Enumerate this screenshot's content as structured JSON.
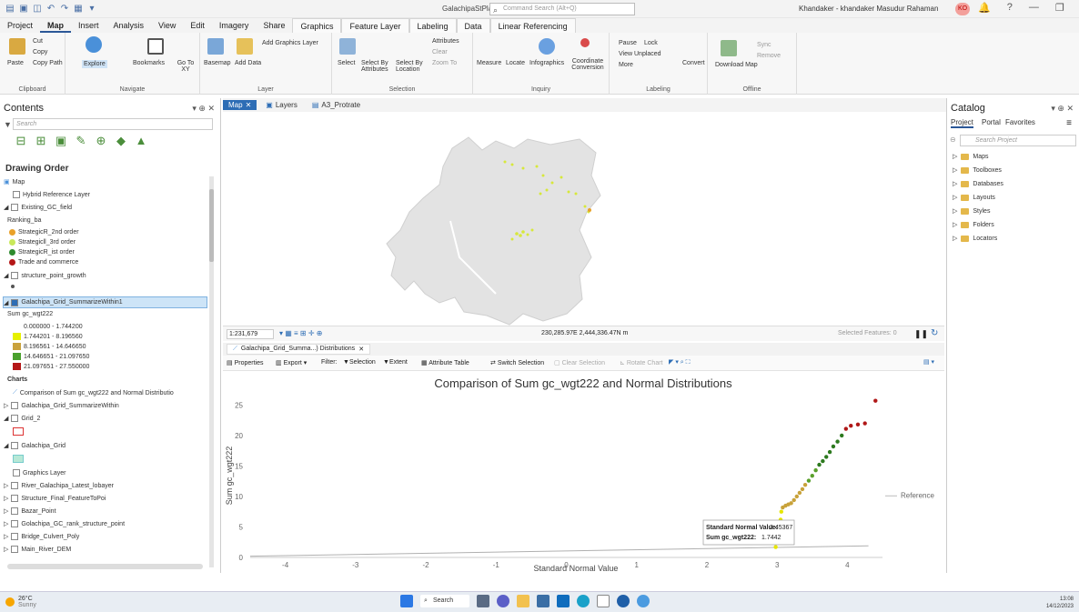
{
  "titlebar": {
    "app_title": "GalachipaStPlan",
    "command_search": "Command Search (Alt+Q)",
    "user": "Khandaker - khandaker Masudur Rahaman",
    "user_initials": "KO"
  },
  "ribbon_tabs": [
    "Project",
    "Map",
    "Insert",
    "Analysis",
    "View",
    "Edit",
    "Imagery",
    "Share",
    "Graphics",
    "Feature Layer",
    "Labeling",
    "Data",
    "Linear Referencing"
  ],
  "ribbon": {
    "clipboard": {
      "paste": "Paste",
      "cut": "Cut",
      "copy": "Copy",
      "copy_path": "Copy Path",
      "label": "Clipboard"
    },
    "navigate": {
      "explore": "Explore",
      "bookmarks": "Bookmarks",
      "goto": "Go To XY",
      "label": "Navigate"
    },
    "layer": {
      "basemap": "Basemap",
      "add_data": "Add Data",
      "add_graphics": "Add Graphics Layer",
      "label": "Layer"
    },
    "selection": {
      "select": "Select",
      "by_attr": "Select By Attributes",
      "by_loc": "Select By Location",
      "attributes": "Attributes",
      "clear": "Clear",
      "zoom_to": "Zoom To",
      "label": "Selection"
    },
    "inquiry": {
      "measure": "Measure",
      "locate": "Locate",
      "infographics": "Infographics",
      "coord": "Coordinate Conversion",
      "label": "Inquiry"
    },
    "labeling": {
      "pause": "Pause",
      "lock": "Lock",
      "view_unplaced": "View Unplaced",
      "more": "More",
      "convert": "Convert",
      "label": "Labeling"
    },
    "offline": {
      "download": "Download Map",
      "sync": "Sync",
      "remove": "Remove",
      "label": "Offline"
    }
  },
  "contents": {
    "title": "Contents",
    "search_placeholder": "Search",
    "drawing_order": "Drawing Order",
    "items": {
      "map": "Map",
      "hybrid": "Hybrid Reference Layer",
      "existing_gc": "Existing_GC_field",
      "ranking": "Ranking_ba",
      "r1": "StrategicR_2nd order",
      "r2": "Strategicll_3rd order",
      "r3": "StrategicR_ist order",
      "r4": "Trade and commerce",
      "spg": "structure_point_growth",
      "gsw1": "Galachipa_Grid_SummarizeWithin1",
      "sum_field": "Sum gc_wgt222",
      "c0": "0.000000 - 1.744200",
      "c1": "1.744201 - 8.196560",
      "c2": "8.196561 - 14.646650",
      "c3": "14.646651 - 21.097650",
      "c4": "21.097651 - 27.550000",
      "charts": "Charts",
      "chart_item": "Comparison of Sum gc_wgt222 and Normal Distributio",
      "gsw": "Galachipa_Grid_SummarizeWithin",
      "grid2": "Grid_2",
      "grid": "Galachipa_Grid",
      "graphics": "Graphics Layer",
      "river": "River_Galachipa_Latest_lobayer",
      "structure": "Structure_Final_FeatureToPoi",
      "bazar": "Bazar_Point",
      "gcrank": "Golachipa_GC_rank_structure_point",
      "bridge": "Bridge_Culvert_Poly",
      "river_dem": "Main_River_DEM"
    }
  },
  "doc_tabs": [
    "Map",
    "Layers",
    "A3_Protrate"
  ],
  "map_status": {
    "scale": "1:231,679",
    "coords": "230,285.97E 2,444,336.47N m",
    "selected": "Selected Features: 0"
  },
  "chart_pane": {
    "tab": "Galachipa_Grid_Summa...) Distributions",
    "toolbar": {
      "properties": "Properties",
      "export": "Export",
      "filter": "Filter:",
      "selection": "Selection",
      "extent": "Extent",
      "attr_table": "Attribute Table",
      "switch": "Switch Selection",
      "clear": "Clear Selection",
      "rotate": "Rotate Chart"
    }
  },
  "chart_data": {
    "type": "scatter",
    "title": "Comparison of Sum gc_wgt222 and Normal Distributions",
    "xlabel": "Standard Normal Value",
    "ylabel": "Sum gc_wgt222",
    "xlim": [
      -4.5,
      4.5
    ],
    "ylim": [
      0,
      27
    ],
    "xticks": [
      "-4",
      "-3",
      "-2",
      "-1",
      "0",
      "1",
      "2",
      "3",
      "4"
    ],
    "yticks": [
      "0",
      "5",
      "10",
      "15",
      "20",
      "25"
    ],
    "reference_label": "Reference",
    "tooltip": {
      "line1_label": "Standard Normal Value:",
      "line1_value": "2.45367",
      "line2_label": "Sum gc_wgt222:",
      "line2_value": "1.7442"
    },
    "points": [
      {
        "x": 2.98,
        "y": 1.7
      },
      {
        "x": 3.0,
        "y": 2.5
      },
      {
        "x": 3.02,
        "y": 3.8
      },
      {
        "x": 3.04,
        "y": 5.0
      },
      {
        "x": 3.05,
        "y": 6.2
      },
      {
        "x": 3.06,
        "y": 7.5
      },
      {
        "x": 3.08,
        "y": 8.2
      },
      {
        "x": 3.12,
        "y": 8.5
      },
      {
        "x": 3.16,
        "y": 8.7
      },
      {
        "x": 3.2,
        "y": 8.9
      },
      {
        "x": 3.24,
        "y": 9.4
      },
      {
        "x": 3.28,
        "y": 10.0
      },
      {
        "x": 3.32,
        "y": 10.6
      },
      {
        "x": 3.36,
        "y": 11.2
      },
      {
        "x": 3.4,
        "y": 11.9
      },
      {
        "x": 3.45,
        "y": 12.6
      },
      {
        "x": 3.5,
        "y": 13.4
      },
      {
        "x": 3.55,
        "y": 14.3
      },
      {
        "x": 3.6,
        "y": 15.2
      },
      {
        "x": 3.65,
        "y": 15.8
      },
      {
        "x": 3.7,
        "y": 16.5
      },
      {
        "x": 3.75,
        "y": 17.3
      },
      {
        "x": 3.8,
        "y": 18.2
      },
      {
        "x": 3.86,
        "y": 19.0
      },
      {
        "x": 3.92,
        "y": 20.0
      },
      {
        "x": 3.98,
        "y": 21.1
      },
      {
        "x": 4.05,
        "y": 21.6
      },
      {
        "x": 4.15,
        "y": 21.8
      },
      {
        "x": 4.25,
        "y": 22.0
      },
      {
        "x": 4.4,
        "y": 25.7
      }
    ],
    "colors": {
      "low": "#e6e600",
      "mid1": "#c8a23a",
      "mid2": "#5aa02c",
      "high": "#2d7a1f",
      "top": "#b01818"
    }
  },
  "catalog": {
    "title": "Catalog",
    "tabs": [
      "Project",
      "Portal",
      "Favorites"
    ],
    "search_placeholder": "Search Project",
    "items": [
      "Maps",
      "Toolboxes",
      "Databases",
      "Layouts",
      "Styles",
      "Folders",
      "Locators"
    ]
  },
  "taskbar": {
    "temp": "26°C",
    "weather": "Sunny",
    "search": "Search",
    "time": "13:08",
    "date": "14/12/2023"
  }
}
